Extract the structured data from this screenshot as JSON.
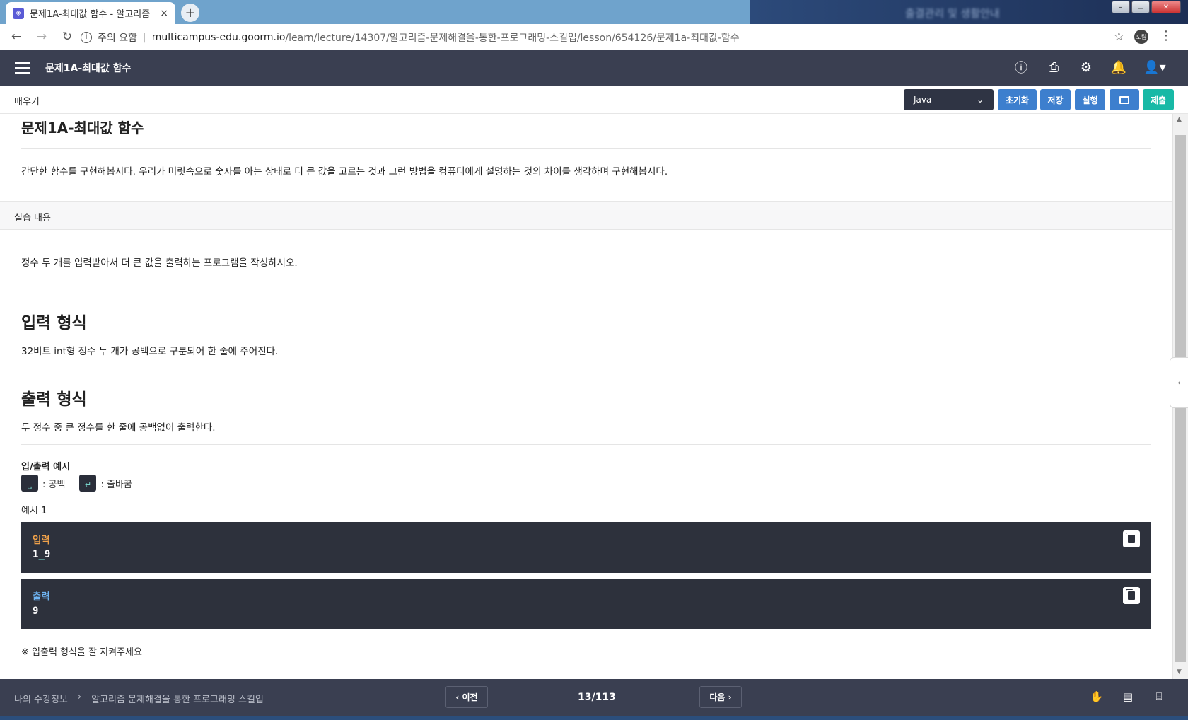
{
  "browser": {
    "tab_title": "문제1A-최대값 함수 - 알고리즘",
    "tab_close": "×",
    "new_tab": "+",
    "desktop_text": "출결관리 및 생활안내",
    "security_label": "주의 요함",
    "url_domain": "multicampus-edu.goorm.io",
    "url_path": "/learn/lecture/14307/알고리즘-문제해결을-통한-프로그래밍-스킬업/lesson/654126/문제1a-최대값-함수",
    "profile_label": "도림"
  },
  "app": {
    "title": "문제1A-최대값 함수"
  },
  "toolbar": {
    "learn_label": "배우기",
    "language": "Java",
    "reset_label": "초기화",
    "save_label": "저장",
    "run_label": "실행",
    "submit_label": "제출"
  },
  "content": {
    "problem_title": "문제1A-최대값 함수",
    "intro": "간단한 함수를 구현해봅시다. 우리가 머릿속으로 숫자를 아는 상태로 더 큰 값을 고르는 것과 그런 방법을 컴퓨터에게 설명하는 것의 차이를 생각하며 구현해봅시다.",
    "section_label": "실습 내용",
    "task": "정수 두 개를 입력받아서 더 큰 값을 출력하는 프로그램을 작성하시오.",
    "input_heading": "입력 형식",
    "input_desc": "32비트 int형 정수 두 개가 공백으로 구분되어 한 줄에 주어진다.",
    "output_heading": "출력 형식",
    "output_desc": "두 정수 중 큰 정수를 한 줄에 공백없이 출력한다.",
    "io_example_label": "입/출력 예시",
    "legend_space": ": 공백",
    "legend_newline": ": 줄바꿈",
    "example_label": "예시 1",
    "input_label": "입력",
    "input_value_a": "1",
    "input_value_b": "9",
    "output_label": "출력",
    "output_value": "9",
    "note": "※ 입출력 형식을 잘 지켜주세요"
  },
  "footer": {
    "crumb_1": "나의 수강정보",
    "crumb_sep": "›",
    "crumb_2": "알고리즘 문제해결을 통한 프로그래밍 스킬업",
    "prev_label": "‹ 이전",
    "page_indicator": "13/113",
    "next_label": "다음 ›"
  },
  "colors": {
    "header_bg": "#3a3f51",
    "button_blue": "#3d7fce",
    "button_teal": "#18b9a6",
    "code_bg": "#2d313c",
    "input_label": "#f0a24a",
    "output_label": "#6fb6f5"
  }
}
